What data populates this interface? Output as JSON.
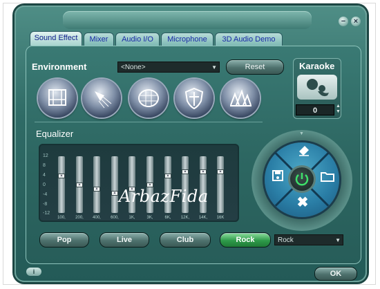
{
  "tabs": [
    {
      "label": "Sound Effect",
      "active": true
    },
    {
      "label": "Mixer",
      "active": false
    },
    {
      "label": "Audio I/O",
      "active": false
    },
    {
      "label": "Microphone",
      "active": false
    },
    {
      "label": "3D Audio Demo",
      "active": false
    }
  ],
  "window_controls": {
    "minimize": "−",
    "close": "×"
  },
  "environment": {
    "label": "Environment",
    "selected": "<None>",
    "reset_label": "Reset",
    "presets": [
      {
        "icon": "bathroom-icon"
      },
      {
        "icon": "shower-icon"
      },
      {
        "icon": "stadium-icon"
      },
      {
        "icon": "knight-shield-icon"
      },
      {
        "icon": "opera-house-icon"
      }
    ]
  },
  "karaoke": {
    "label": "Karaoke",
    "value": "0",
    "icon": "karaoke-singer-icon"
  },
  "equalizer": {
    "label": "Equalizer",
    "scale": [
      "12",
      "8",
      "4",
      "0",
      "-4",
      "-8",
      "-12"
    ],
    "bands": [
      {
        "freq": "100",
        "level_db": 4
      },
      {
        "freq": "200",
        "level_db": 0
      },
      {
        "freq": "400",
        "level_db": -2
      },
      {
        "freq": "600",
        "level_db": -4
      },
      {
        "freq": "1K",
        "level_db": -2
      },
      {
        "freq": "3K",
        "level_db": 0
      },
      {
        "freq": "6K",
        "level_db": 4
      },
      {
        "freq": "12K",
        "level_db": 6
      },
      {
        "freq": "14K",
        "level_db": 6
      },
      {
        "freq": "16K",
        "level_db": 6
      }
    ],
    "presets": [
      {
        "label": "Pop",
        "active": false
      },
      {
        "label": "Live",
        "active": false
      },
      {
        "label": "Club",
        "active": false
      },
      {
        "label": "Rock",
        "active": true
      }
    ],
    "preset_select": "Rock"
  },
  "watermark": "ArbazFida",
  "control_wheel": {
    "top": "eraser-icon",
    "left": "save-disk-icon",
    "right": "folder-icon",
    "bottom": "delete-x-icon",
    "center": "power-icon"
  },
  "footer": {
    "info_label": "i",
    "ok_label": "OK"
  },
  "colors": {
    "accent": "#2e9a4a",
    "panel": "#2d6762",
    "tab_text": "#1a2aa6"
  }
}
